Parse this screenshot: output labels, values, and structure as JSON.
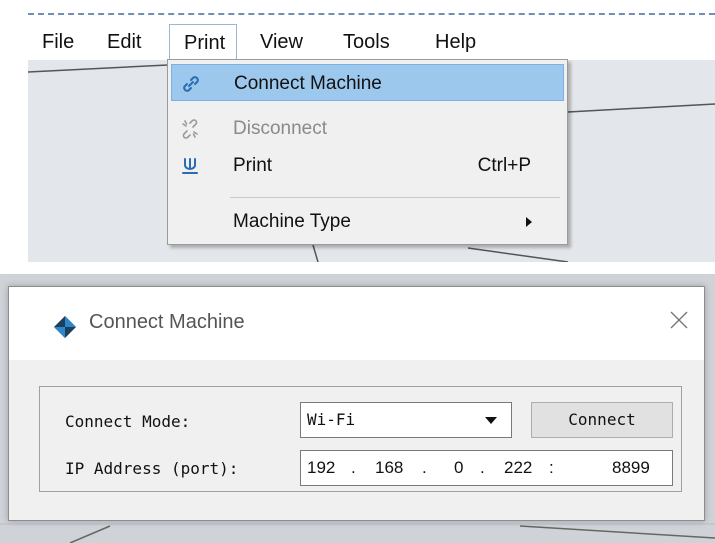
{
  "menubar": {
    "items": [
      "File",
      "Edit",
      "Print",
      "View",
      "Tools",
      "Help"
    ],
    "active": "Print"
  },
  "print_menu": {
    "items": [
      {
        "label": "Connect Machine",
        "icon": "link-icon",
        "shortcut": "",
        "state": "highlighted"
      },
      {
        "label": "Disconnect",
        "icon": "broken-link-icon",
        "shortcut": "",
        "state": "disabled"
      },
      {
        "label": "Print",
        "icon": "print-icon",
        "shortcut": "Ctrl+P",
        "state": "normal"
      },
      {
        "label": "Machine Type",
        "icon": "",
        "shortcut": "",
        "state": "submenu"
      }
    ]
  },
  "dialog": {
    "title": "Connect Machine",
    "connect_mode_label": "Connect Mode:",
    "connect_mode_value": "Wi-Fi",
    "connect_button": "Connect",
    "ip_label": "IP Address (port):",
    "ip": {
      "a": "192",
      "b": "168",
      "c": "0",
      "d": "222",
      "port": "8899"
    }
  },
  "colors": {
    "menu_highlight": "#9cc8ee",
    "menu_background": "#f0f0f0",
    "disabled_text": "#8a8a8a",
    "icon_blue": "#2b6cb0",
    "dialog_body": "#f0f0f0"
  }
}
